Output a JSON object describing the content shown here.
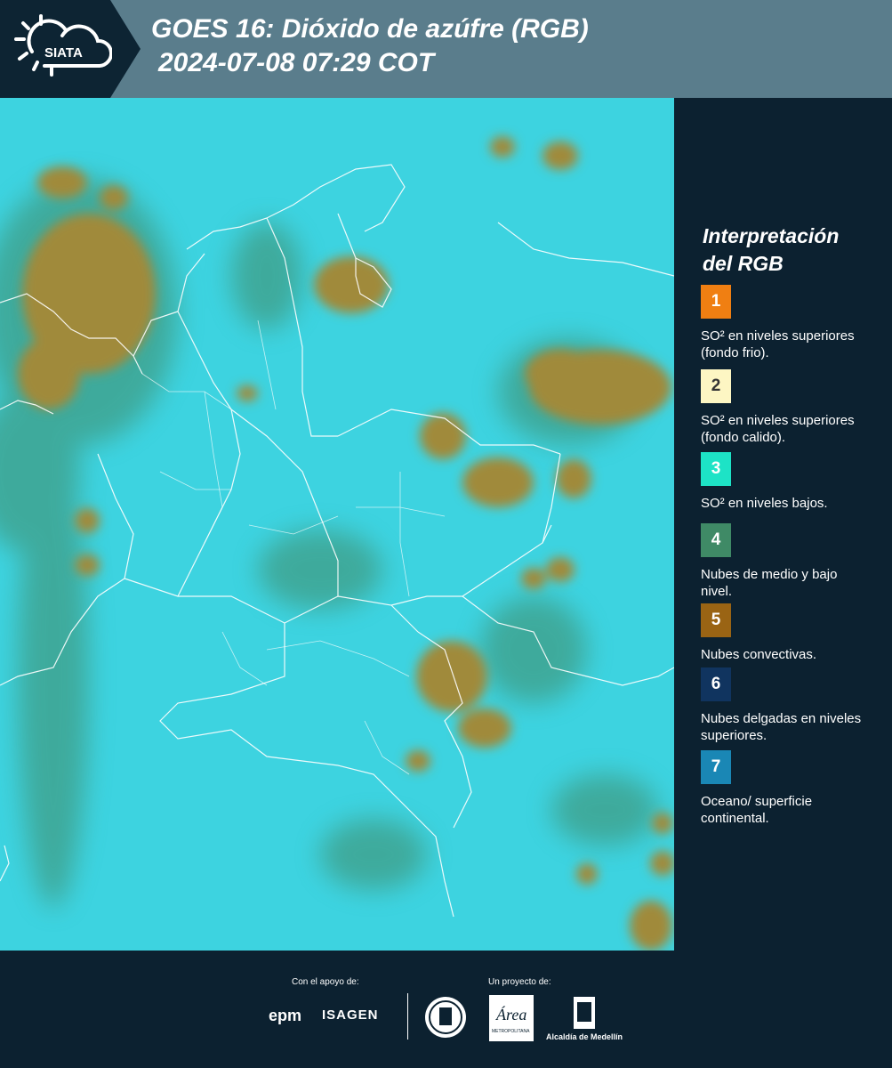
{
  "header": {
    "logo_text": "SIATA",
    "title_line1": "GOES 16: Dióxido de azúfre (RGB)",
    "title_line2": "2024-07-08 07:29 COT"
  },
  "legend": {
    "title_line1": "Interpretación",
    "title_line2": "del RGB",
    "items": [
      {
        "number": "1",
        "color": "#f07f12",
        "text": "SO² en niveles superiores (fondo frio)."
      },
      {
        "number": "2",
        "color": "#fdf6c3",
        "text": "SO² en niveles superiores (fondo calido)."
      },
      {
        "number": "3",
        "color": "#1de3c6",
        "text": "SO² en niveles bajos."
      },
      {
        "number": "4",
        "color": "#3f8a66",
        "text": "Nubes de medio y bajo nivel."
      },
      {
        "number": "5",
        "color": "#9a6414",
        "text": "Nubes convectivas."
      },
      {
        "number": "6",
        "color": "#10345f",
        "text": "Nubes delgadas en niveles superiores."
      },
      {
        "number": "7",
        "color": "#1a87b5",
        "text": "Oceano/ superficie continental."
      }
    ]
  },
  "map": {
    "background_color": "#38d2e0",
    "cloud_color": "#a08a3a",
    "low_cloud_color": "#3f8a66",
    "border_color": "#ffffff"
  },
  "footer": {
    "support_label": "Con el apoyo de:",
    "project_label": "Un proyecto de:",
    "sponsor1": "epm",
    "sponsor2": "ISAGEN",
    "partner1_icon": "medellin-seal-icon",
    "partner2": "Área",
    "partner2_sub": "METROPOLITANA",
    "partner3": "Alcaldía de Medellín"
  }
}
